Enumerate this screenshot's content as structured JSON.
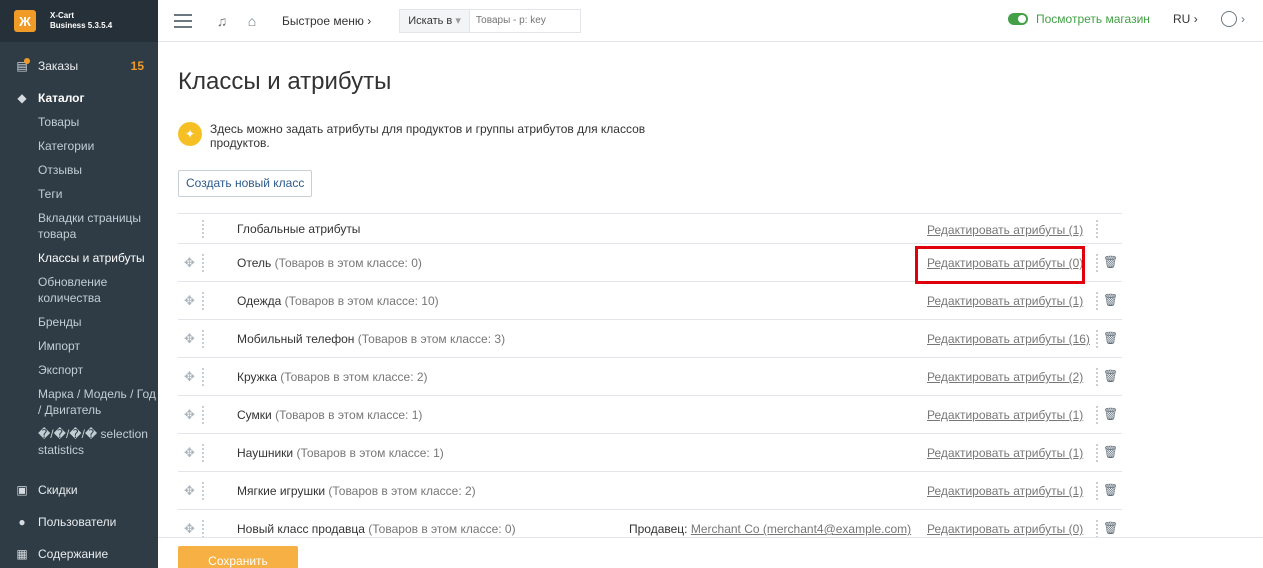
{
  "brand": {
    "logo": "Ж",
    "name_line1": "X-Cart",
    "name_line2": "Business 5.3.5.4"
  },
  "sidebar": {
    "orders": {
      "label": "Заказы",
      "badge": "15"
    },
    "catalog": {
      "label": "Каталог"
    },
    "catalog_items": [
      "Товары",
      "Категории",
      "Отзывы",
      "Теги",
      "Вкладки страницы товара",
      "Классы и атрибуты",
      "Обновление количества",
      "Бренды",
      "Импорт",
      "Экспорт",
      "Марка / Модель / Год / Двигатель",
      "�/�/�/� selection statistics"
    ],
    "discounts": {
      "label": "Скидки"
    },
    "users": {
      "label": "Пользователи"
    },
    "content": {
      "label": "Содержание"
    }
  },
  "topbar": {
    "quick_menu": "Быстрое меню",
    "search_in": "Искать в",
    "search_placeholder": "Товары - p: key",
    "view_store": "Посмотреть магазин",
    "lang": "RU"
  },
  "page": {
    "title": "Классы и атрибуты",
    "hint": "Здесь можно задать атрибуты для продуктов и группы атрибутов для классов продуктов.",
    "create_button": "Создать новый класс",
    "save_button": "Сохранить"
  },
  "classes": [
    {
      "name": "Глобальные атрибуты",
      "count": "",
      "seller_label": "",
      "seller": "",
      "edit": "Редактировать атрибуты (1)"
    },
    {
      "name": "Отель",
      "count": "(Товаров в этом классе: 0)",
      "seller_label": "",
      "seller": "",
      "edit": "Редактировать атрибуты (0)"
    },
    {
      "name": "Одежда",
      "count": "(Товаров в этом классе: 10)",
      "seller_label": "",
      "seller": "",
      "edit": "Редактировать атрибуты (1)"
    },
    {
      "name": "Мобильный телефон",
      "count": "(Товаров в этом классе: 3)",
      "seller_label": "",
      "seller": "",
      "edit": "Редактировать атрибуты (16)"
    },
    {
      "name": "Кружка",
      "count": "(Товаров в этом классе: 2)",
      "seller_label": "",
      "seller": "",
      "edit": "Редактировать атрибуты (2)"
    },
    {
      "name": "Сумки",
      "count": "(Товаров в этом классе: 1)",
      "seller_label": "",
      "seller": "",
      "edit": "Редактировать атрибуты (1)"
    },
    {
      "name": "Наушники",
      "count": "(Товаров в этом классе: 1)",
      "seller_label": "",
      "seller": "",
      "edit": "Редактировать атрибуты (1)"
    },
    {
      "name": "Мягкие игрушки",
      "count": "(Товаров в этом классе: 2)",
      "seller_label": "",
      "seller": "",
      "edit": "Редактировать атрибуты (1)"
    },
    {
      "name": "Новый класс продавца",
      "count": "(Товаров в этом классе: 0)",
      "seller_label": "Продавец:",
      "seller": "Merchant Co (merchant4@example.com)",
      "edit": "Редактировать атрибуты (0)"
    }
  ]
}
